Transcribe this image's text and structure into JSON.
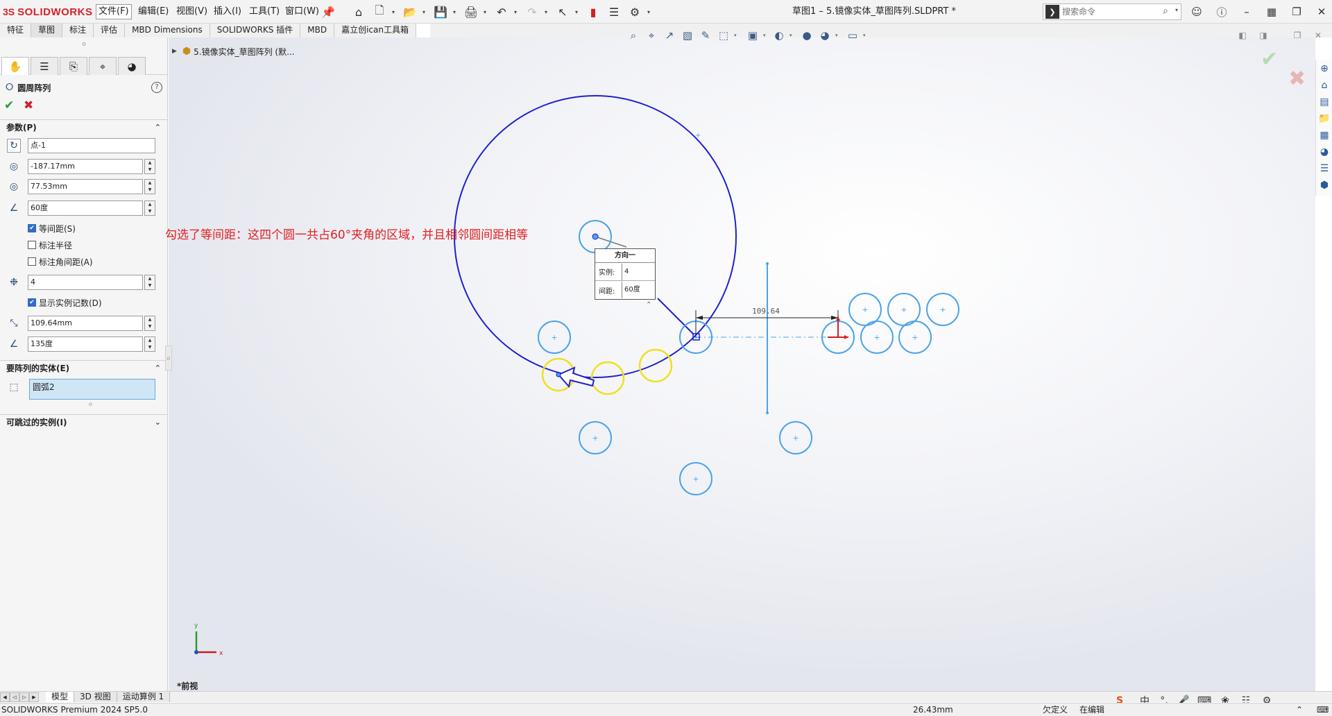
{
  "app": {
    "logo_text": "SOLIDWORKS",
    "doc_title": "草图1 – 5.镜像实体_草图阵列.SLDPRT *"
  },
  "menu": {
    "file": "文件(F)",
    "edit": "编辑(E)",
    "view": "视图(V)",
    "insert": "插入(I)",
    "tools": "工具(T)",
    "window": "窗口(W)"
  },
  "search": {
    "placeholder": "搜索命令"
  },
  "cmdtabs": [
    "特征",
    "草图",
    "标注",
    "评估",
    "MBD Dimensions",
    "SOLIDWORKS 插件",
    "MBD",
    "嘉立创ican工具箱"
  ],
  "pm": {
    "title": "圆周阵列",
    "section_params": "参数(P)",
    "center_point": "点-1",
    "x_value": "-187.17mm",
    "y_value": "77.53mm",
    "angle": "60度",
    "equal_spacing": "等间距(S)",
    "equal_spacing_checked": true,
    "dim_radius": "标注半径",
    "dim_radius_checked": false,
    "dim_angle": "标注角间距(A)",
    "dim_angle_checked": false,
    "instances": "4",
    "show_count": "显示实例记数(D)",
    "show_count_checked": true,
    "radius": "109.64mm",
    "arc_angle": "135度",
    "section_entities": "要阵列的实体(E)",
    "entity": "圆弧2",
    "section_skip": "可跳过的实例(I)"
  },
  "tree": {
    "node": "5.镜像实体_草图阵列 (默..."
  },
  "annotation": "勾选了等间距：这四个圆一共占60°夹角的区域，并且相邻圆间距相等",
  "popup": {
    "title": "方向一",
    "instances_label": "实例:",
    "instances_value": "4",
    "spacing_label": "间距:",
    "spacing_value": "60度"
  },
  "dimension": "109.64",
  "triad": {
    "x": "x",
    "y": "y"
  },
  "view_label": "*前视",
  "bottom_tabs": [
    "模型",
    "3D 视图",
    "运动算例 1"
  ],
  "status": {
    "version": "SOLIDWORKS Premium 2024 SP5.0",
    "coord": "26.43mm",
    "defined": "欠定义",
    "editing": "在编辑"
  },
  "ime": {
    "lang": "中"
  },
  "colors": {
    "sketch_blue": "#1f1fd0",
    "light_blue": "#4aa3ea",
    "preview_yellow": "#f0e020",
    "annotation_red": "#e02020",
    "logo_red": "#d6202b"
  }
}
